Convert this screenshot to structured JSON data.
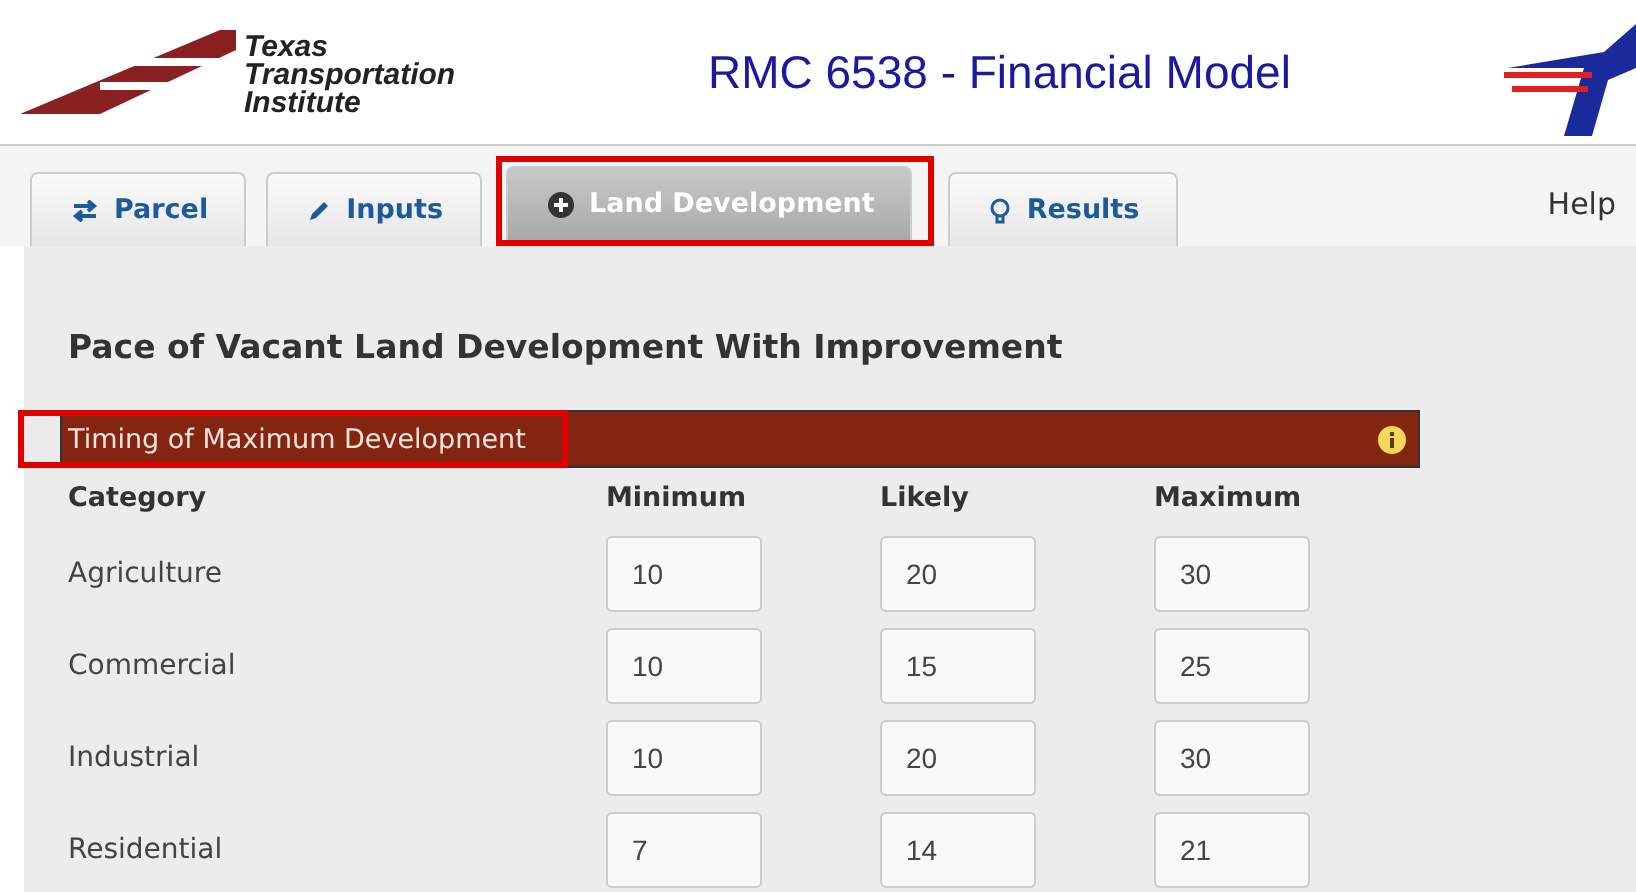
{
  "header": {
    "logo_lines": [
      "Texas",
      "Transportation",
      "Institute"
    ],
    "title": "RMC 6538 - Financial Model"
  },
  "tabs": [
    {
      "label": "Parcel",
      "kind": "arrows",
      "selected": false,
      "highlighted": false
    },
    {
      "label": "Inputs",
      "kind": "pencil",
      "selected": false,
      "highlighted": false
    },
    {
      "label": "Land Development",
      "kind": "plus",
      "selected": true,
      "highlighted": true
    },
    {
      "label": "Results",
      "kind": "bulb",
      "selected": false,
      "highlighted": false
    }
  ],
  "help": "Help",
  "section": {
    "title": "Pace of Vacant Land Development With Improvement",
    "bar_label": "Timing of Maximum Development",
    "bar_highlighted": true
  },
  "table": {
    "columns": [
      "Category",
      "Minimum",
      "Likely",
      "Maximum"
    ],
    "rows": [
      {
        "category": "Agriculture",
        "values": [
          "10",
          "20",
          "30"
        ]
      },
      {
        "category": "Commercial",
        "values": [
          "10",
          "15",
          "25"
        ]
      },
      {
        "category": "Industrial",
        "values": [
          "10",
          "20",
          "30"
        ]
      },
      {
        "category": "Residential",
        "values": [
          "7",
          "14",
          "21"
        ]
      }
    ]
  }
}
